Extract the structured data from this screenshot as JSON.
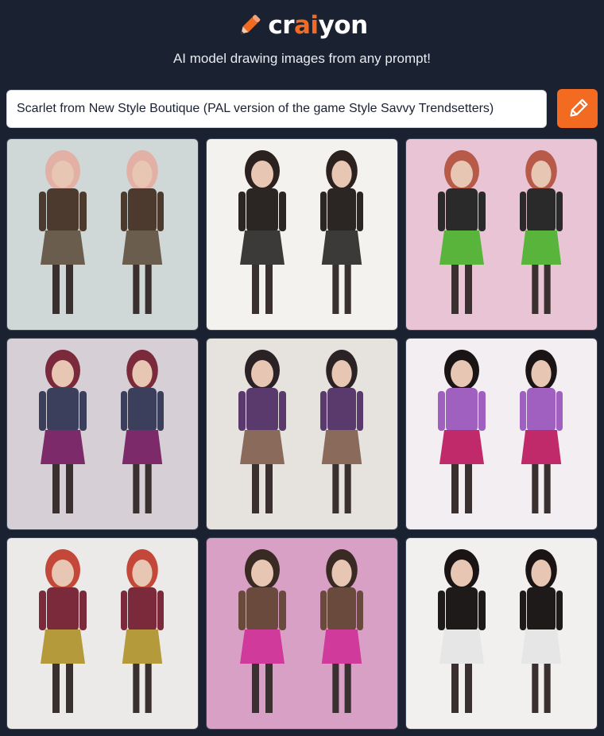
{
  "brand": {
    "name_part1": "cr",
    "name_accent": "ai",
    "name_part2": "yon",
    "tagline": "AI model drawing images from any prompt!",
    "accent_color": "#f26b21",
    "logo_icon": "pencil-icon"
  },
  "prompt": {
    "value": "Scarlet from New Style Boutique (PAL version of the game Style Savvy Trendsetters)",
    "draw_button_icon": "pencil-icon"
  },
  "gallery": {
    "images": [
      {
        "label": "Generated image 1",
        "bg": "#cfd8d6",
        "outfit": "#4d3a2e",
        "skirt": "#6b5d4e",
        "hair": "#e2b0a4"
      },
      {
        "label": "Generated image 2",
        "bg": "#f4f2ef",
        "outfit": "#2b2624",
        "skirt": "#3c3a38",
        "hair": "#2b2220"
      },
      {
        "label": "Generated image 3",
        "bg": "#e8c4d4",
        "outfit": "#2a2a2a",
        "skirt": "#58b43a",
        "hair": "#b85a4a"
      },
      {
        "label": "Generated image 4",
        "bg": "#d6d0d6",
        "outfit": "#3b3f5b",
        "skirt": "#7d2a6a",
        "hair": "#7a2a3a"
      },
      {
        "label": "Generated image 5",
        "bg": "#e6e2de",
        "outfit": "#5a3a6c",
        "skirt": "#8a6a5a",
        "hair": "#2a2224"
      },
      {
        "label": "Generated image 6",
        "bg": "#f2eef2",
        "outfit": "#a060c0",
        "skirt": "#c02a6a",
        "hair": "#1a1414"
      },
      {
        "label": "Generated image 7",
        "bg": "#eceae8",
        "outfit": "#7a2a3a",
        "skirt": "#b49a3a",
        "hair": "#c4483a"
      },
      {
        "label": "Generated image 8",
        "bg": "#d8a0c4",
        "outfit": "#6a4a3c",
        "skirt": "#d03a9a",
        "hair": "#3a2a24"
      },
      {
        "label": "Generated image 9",
        "bg": "#f2f0ee",
        "outfit": "#1e1a1a",
        "skirt": "#e6e6e6",
        "hair": "#1a1414"
      }
    ]
  }
}
